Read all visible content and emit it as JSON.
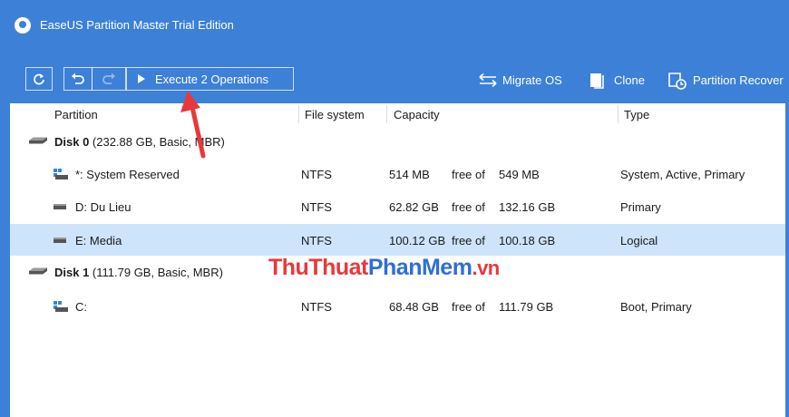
{
  "window": {
    "title": "EaseUS Partition Master Trial Edition"
  },
  "toolbar": {
    "execute_label": "Execute 2 Operations",
    "migrate_label": "Migrate OS",
    "clone_label": "Clone",
    "recovery_label": "Partition Recover"
  },
  "columns": {
    "partition": "Partition",
    "filesystem": "File system",
    "capacity": "Capacity",
    "type": "Type"
  },
  "disks": [
    {
      "name": "Disk 0",
      "info": " (232.88 GB, Basic, MBR)",
      "partitions": [
        {
          "name": "*: System Reserved",
          "fs": "NTFS",
          "used": "514 MB",
          "free_of": "free of",
          "total": "549 MB",
          "type": "System, Active, Primary"
        },
        {
          "name": "D: Du Lieu",
          "fs": "NTFS",
          "used": "62.82 GB",
          "free_of": "free of",
          "total": "132.16 GB",
          "type": "Primary"
        },
        {
          "name": "E: Media",
          "fs": "NTFS",
          "used": "100.12 GB",
          "free_of": "free of",
          "total": "100.18 GB",
          "type": "Logical"
        }
      ]
    },
    {
      "name": "Disk 1",
      "info": " (111.79 GB, Basic, MBR)",
      "partitions": [
        {
          "name": "C:",
          "fs": "NTFS",
          "used": "68.48 GB",
          "free_of": "free of",
          "total": "111.79 GB",
          "type": "Boot, Primary"
        }
      ]
    }
  ],
  "watermark": {
    "part1": "ThuThuat",
    "part2": "PhanMem",
    "part3": ".vn"
  },
  "colors": {
    "accent": "#3d80d8",
    "selected_row": "#cde4fb",
    "annotation_arrow": "#e8383b"
  }
}
